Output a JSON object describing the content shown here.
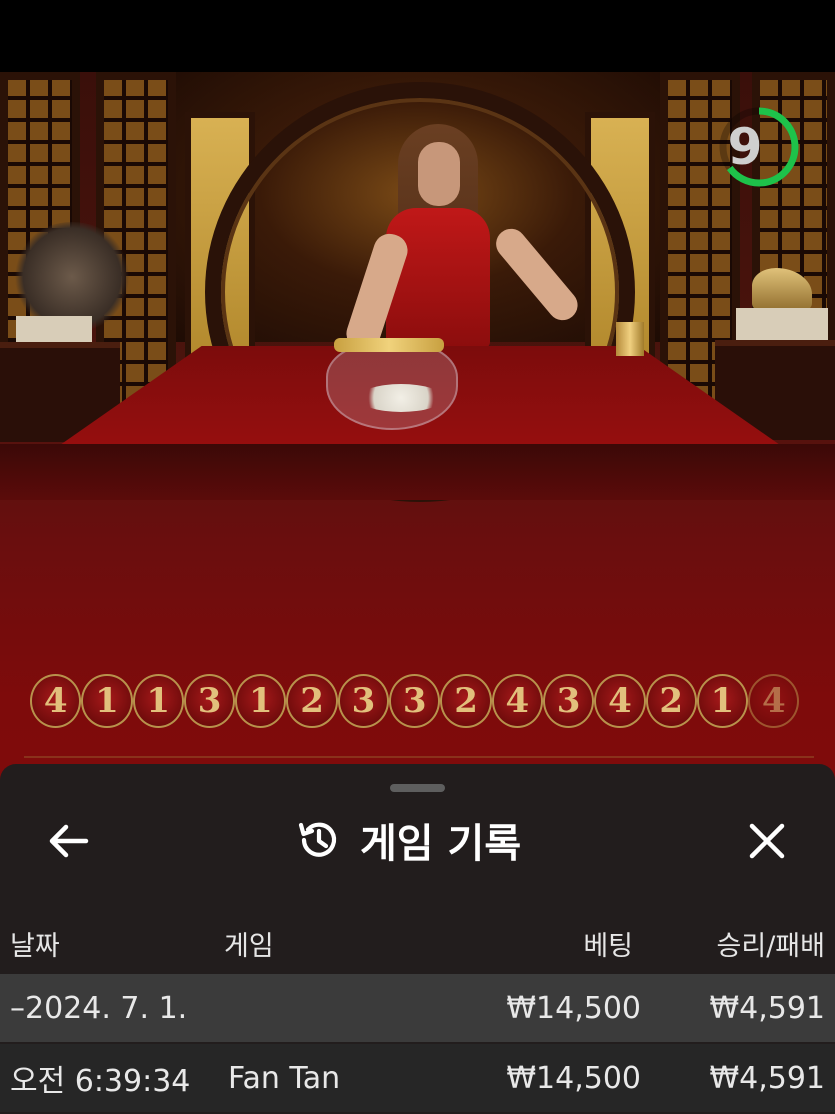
{
  "timer": {
    "value": "9",
    "progress": 0.65,
    "color": "#1ec24a"
  },
  "bead_road": [
    "4",
    "1",
    "1",
    "3",
    "1",
    "2",
    "3",
    "3",
    "2",
    "4",
    "3",
    "4",
    "2",
    "1",
    "4"
  ],
  "sheet": {
    "title": "게임 기록",
    "back_icon": "arrow-left-icon",
    "history_icon": "history-icon",
    "close_icon": "close-icon",
    "columns": {
      "date": "날짜",
      "game": "게임",
      "bet": "베팅",
      "win_loss": "승리/패배"
    },
    "date_row": {
      "date": "–2024. 7. 1.",
      "bet": "₩14,500",
      "win_loss": "₩4,591"
    },
    "game_row": {
      "time": "오전 6:39:34",
      "game": "Fan Tan",
      "bet": "₩14,500",
      "win_loss": "₩4,591"
    }
  }
}
